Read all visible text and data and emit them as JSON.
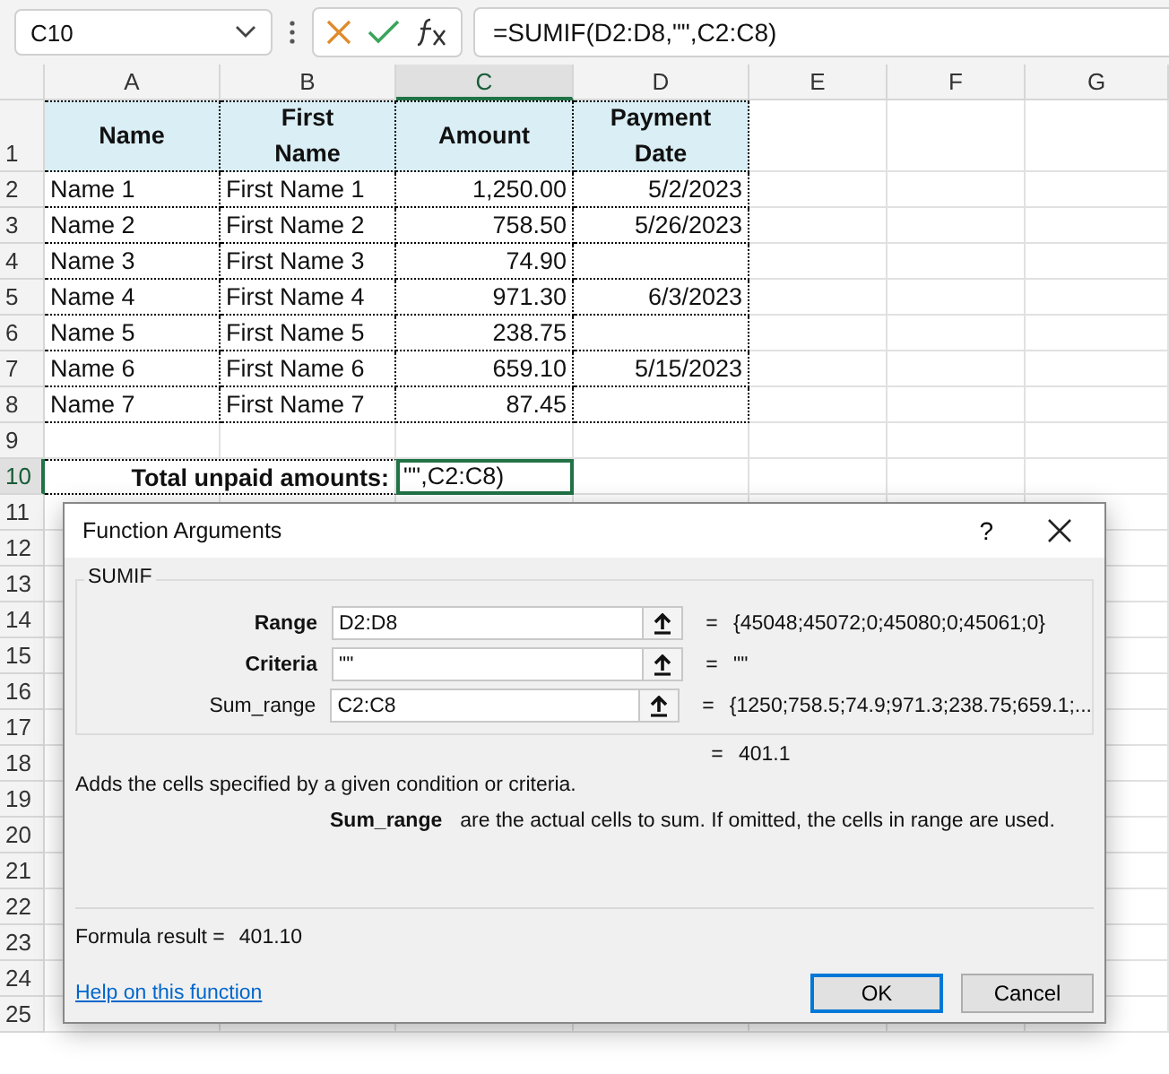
{
  "formula_bar": {
    "name_box": "C10",
    "formula": "=SUMIF(D2:D8,\"\",C2:C8)"
  },
  "columns": [
    {
      "label": "A",
      "selected": false
    },
    {
      "label": "B",
      "selected": false
    },
    {
      "label": "C",
      "selected": true
    },
    {
      "label": "D",
      "selected": false
    },
    {
      "label": "E",
      "selected": false
    },
    {
      "label": "F",
      "selected": false
    },
    {
      "label": "G",
      "selected": false
    }
  ],
  "rows": [
    {
      "label": "1",
      "selected": false,
      "cells": [
        {
          "kind": "header",
          "text": "Name"
        },
        {
          "kind": "header",
          "text": "First Name"
        },
        {
          "kind": "header",
          "text": "Amount"
        },
        {
          "kind": "header",
          "text": "Payment Date"
        }
      ]
    },
    {
      "label": "2",
      "selected": false,
      "cells": [
        {
          "kind": "text",
          "text": "Name 1"
        },
        {
          "kind": "text",
          "text": "First Name 1"
        },
        {
          "kind": "number",
          "text": "1,250.00"
        },
        {
          "kind": "number",
          "text": "5/2/2023"
        }
      ]
    },
    {
      "label": "3",
      "selected": false,
      "cells": [
        {
          "kind": "text",
          "text": "Name 2"
        },
        {
          "kind": "text",
          "text": "First Name 2"
        },
        {
          "kind": "number",
          "text": "758.50"
        },
        {
          "kind": "number",
          "text": "5/26/2023"
        }
      ]
    },
    {
      "label": "4",
      "selected": false,
      "cells": [
        {
          "kind": "text",
          "text": "Name 3"
        },
        {
          "kind": "text",
          "text": "First Name 3"
        },
        {
          "kind": "number",
          "text": "74.90"
        },
        {
          "kind": "empty"
        }
      ]
    },
    {
      "label": "5",
      "selected": false,
      "cells": [
        {
          "kind": "text",
          "text": "Name 4"
        },
        {
          "kind": "text",
          "text": "First Name 4"
        },
        {
          "kind": "number",
          "text": "971.30"
        },
        {
          "kind": "number",
          "text": "6/3/2023"
        }
      ]
    },
    {
      "label": "6",
      "selected": false,
      "cells": [
        {
          "kind": "text",
          "text": "Name 5"
        },
        {
          "kind": "text",
          "text": "First Name 5"
        },
        {
          "kind": "number",
          "text": "238.75"
        },
        {
          "kind": "empty"
        }
      ]
    },
    {
      "label": "7",
      "selected": false,
      "cells": [
        {
          "kind": "text",
          "text": "Name 6"
        },
        {
          "kind": "text",
          "text": "First Name 6"
        },
        {
          "kind": "number",
          "text": "659.10"
        },
        {
          "kind": "number",
          "text": "5/15/2023"
        }
      ]
    },
    {
      "label": "8",
      "selected": false,
      "cells": [
        {
          "kind": "text",
          "text": "Name 7"
        },
        {
          "kind": "text",
          "text": "First Name 7"
        },
        {
          "kind": "number",
          "text": "87.45"
        },
        {
          "kind": "empty"
        }
      ]
    },
    {
      "label": "9",
      "selected": false
    },
    {
      "label": "10",
      "selected": true,
      "cells": [
        {
          "kind": "label",
          "text": "Total unpaid amounts:"
        },
        {
          "kind": "editing",
          "text": "\"\",C2:C8)"
        }
      ]
    },
    {
      "label": "11",
      "selected": false
    },
    {
      "label": "12",
      "selected": false
    },
    {
      "label": "13",
      "selected": false
    },
    {
      "label": "14",
      "selected": false
    },
    {
      "label": "15",
      "selected": false
    },
    {
      "label": "16",
      "selected": false
    },
    {
      "label": "17",
      "selected": false
    },
    {
      "label": "18",
      "selected": false
    },
    {
      "label": "19",
      "selected": false
    },
    {
      "label": "20",
      "selected": false
    },
    {
      "label": "21",
      "selected": false
    },
    {
      "label": "22",
      "selected": false
    },
    {
      "label": "23",
      "selected": false
    },
    {
      "label": "24",
      "selected": false
    },
    {
      "label": "25",
      "selected": false
    }
  ],
  "dialog": {
    "title": "Function Arguments",
    "help": "?",
    "function": "SUMIF",
    "arguments": [
      {
        "label": "Range",
        "required": true,
        "value": "D2:D8",
        "equals": "=",
        "result": "{45048;45072;0;45080;0;45061;0}"
      },
      {
        "label": "Criteria",
        "required": true,
        "value": "\"\"",
        "equals": "=",
        "result": "\"\""
      },
      {
        "label": "Sum_range",
        "required": false,
        "value": "C2:C8",
        "equals": "=",
        "result": "{1250;758.5;74.9;971.3;238.75;659.1;..."
      }
    ],
    "total": {
      "equals": "=",
      "value": "401.1"
    },
    "description": "Adds the cells specified by a given condition or criteria.",
    "argument_help": {
      "name": "Sum_range",
      "text": "are the actual cells to sum. If omitted, the cells in range are used."
    },
    "formula_result_label": "Formula result =",
    "formula_result": "401.10",
    "help_link": "Help on this function",
    "buttons": [
      {
        "label": "OK",
        "default": true
      },
      {
        "label": "Cancel",
        "default": false
      }
    ]
  }
}
